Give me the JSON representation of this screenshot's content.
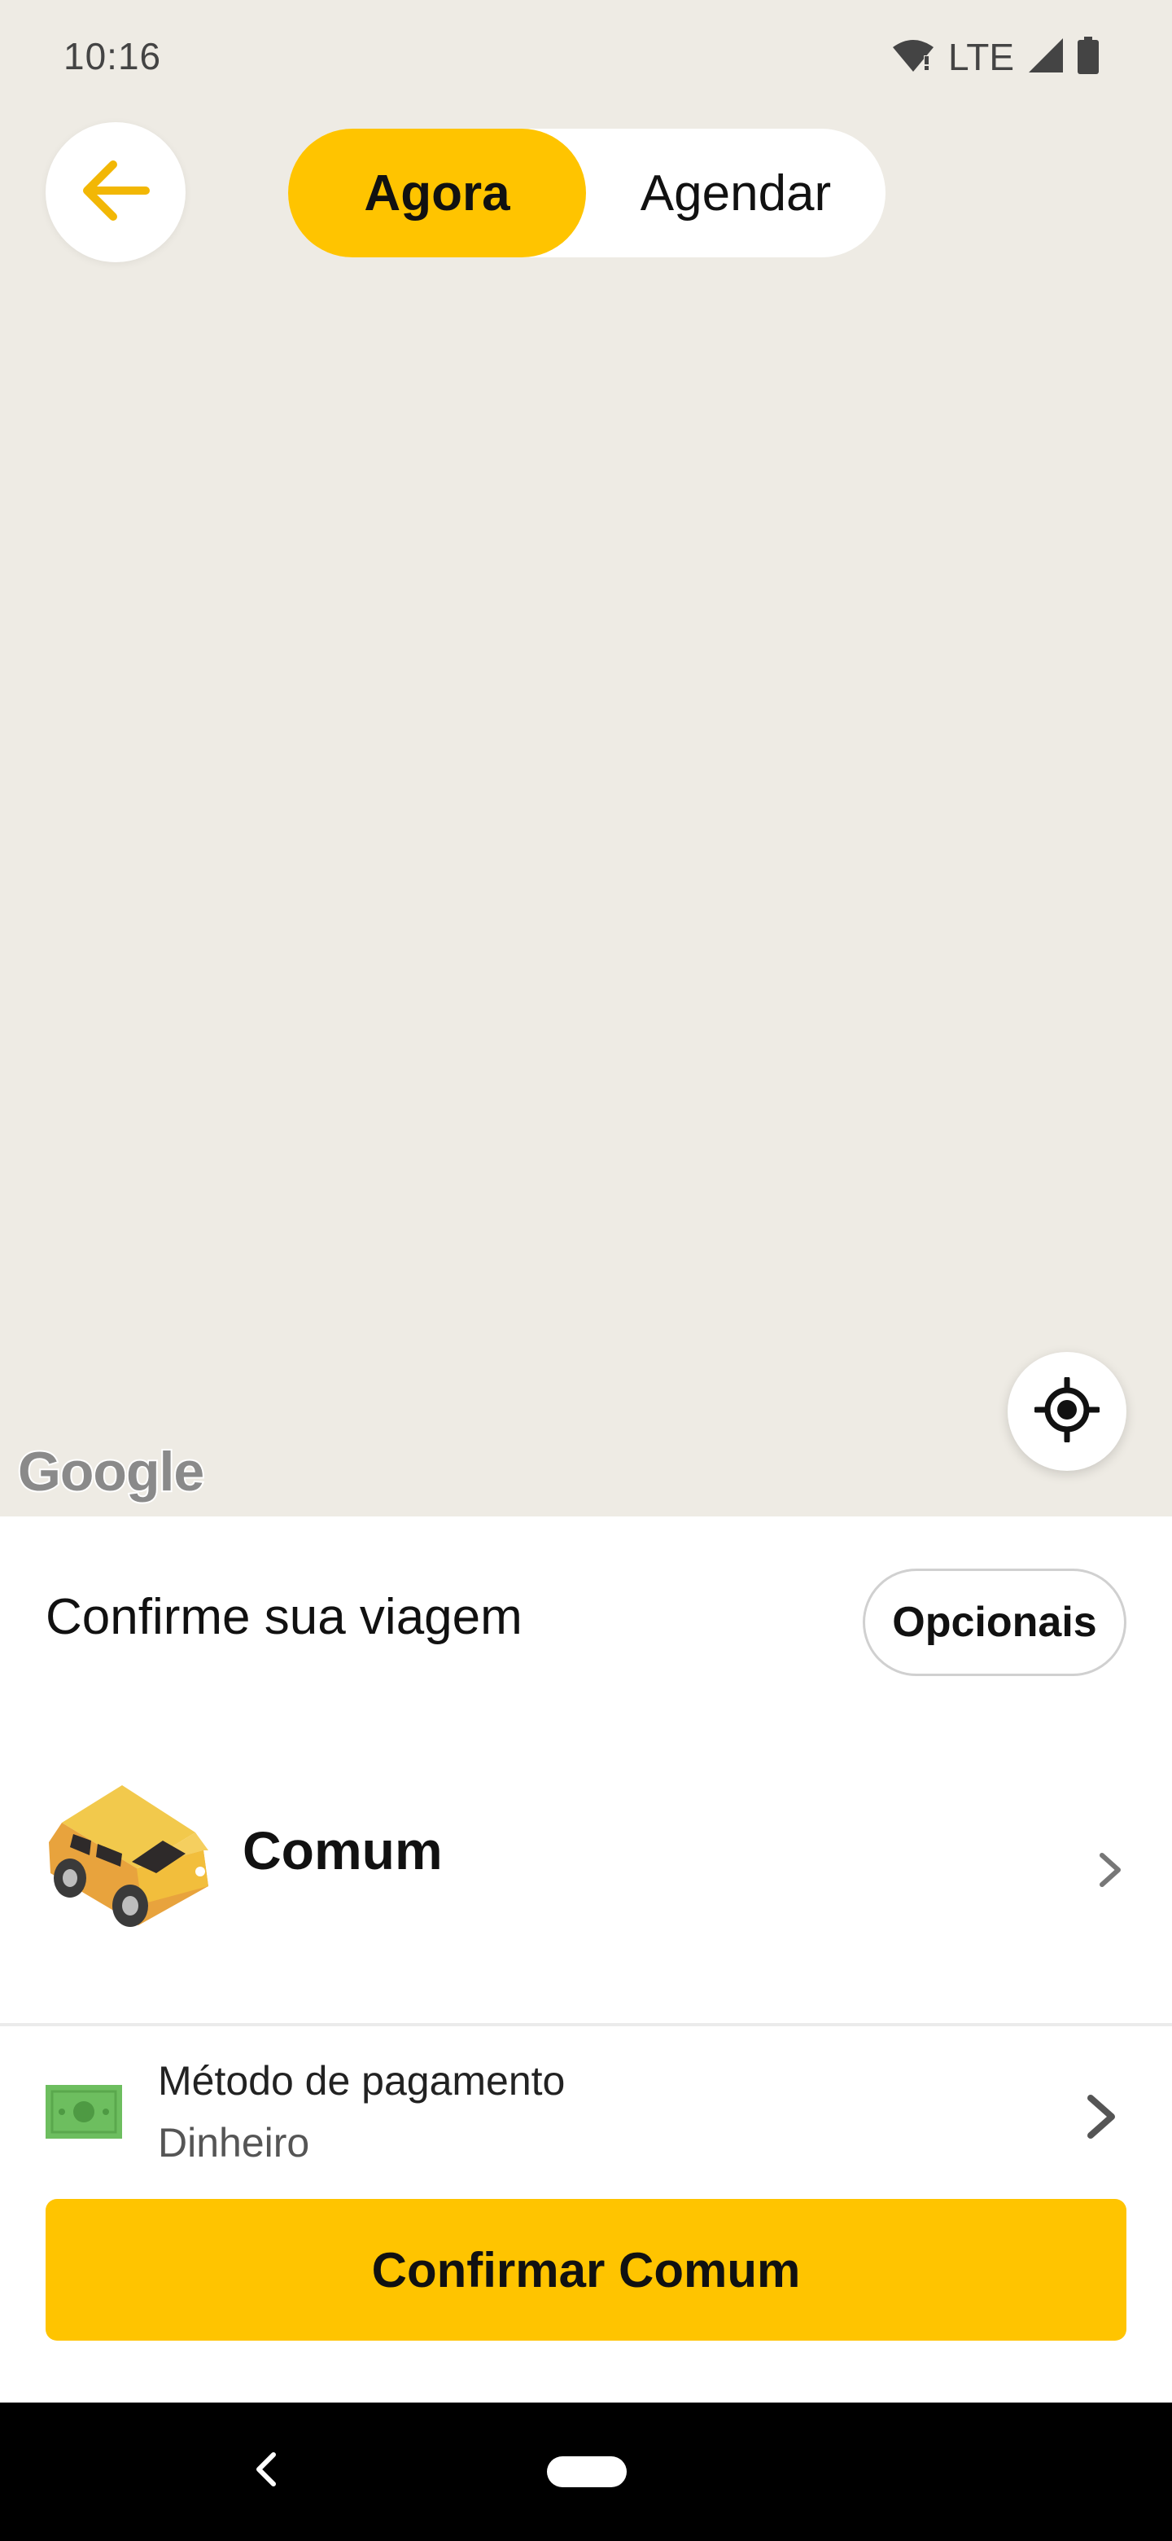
{
  "status_bar": {
    "time": "10:16",
    "network": "LTE",
    "icons": [
      "wifi-icon",
      "signal-icon",
      "battery-icon"
    ]
  },
  "header": {
    "back_icon": "arrow-left-icon",
    "toggle": {
      "options": [
        "Agora",
        "Agendar"
      ],
      "selected": "Agora"
    }
  },
  "map": {
    "attribution": "Google",
    "locate_icon": "my-location-icon"
  },
  "sheet": {
    "title": "Confirme sua viagem",
    "options_label": "Opcionais",
    "ride": {
      "name": "Comum",
      "icon": "car-icon"
    },
    "payment": {
      "label": "Método de pagamento",
      "value": "Dinheiro",
      "icon": "cash-icon"
    },
    "confirm_label": "Confirmar Comum"
  },
  "colors": {
    "accent": "#FFC400",
    "map_background": "#EEEBE4",
    "nav_bar": "#000000"
  }
}
